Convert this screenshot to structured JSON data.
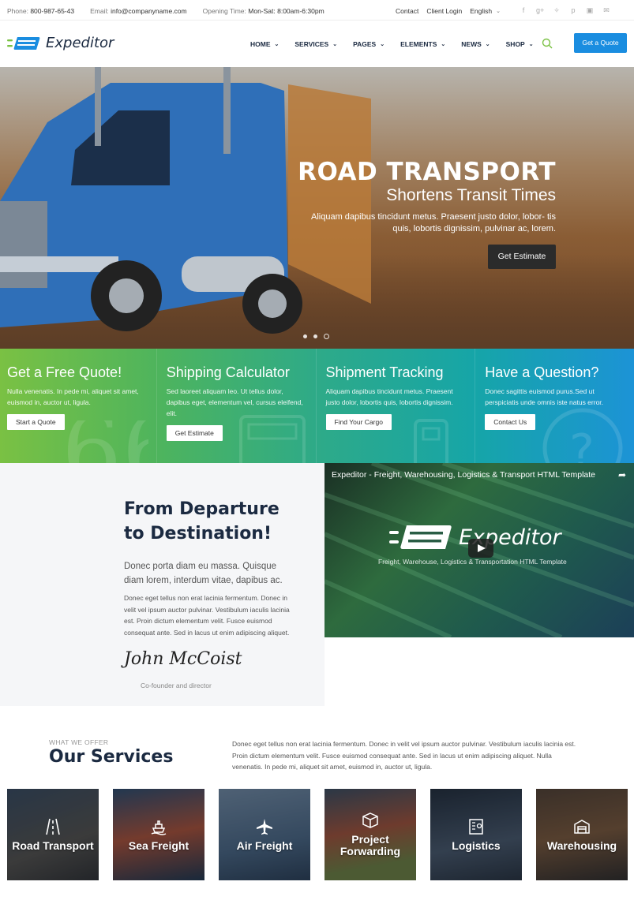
{
  "topbar": {
    "phone_label": "Phone:",
    "phone": "800-987-65-43",
    "email_label": "Email:",
    "email": "info@companyname.com",
    "hours_label": "Opening Time:",
    "hours": "Mon-Sat: 8:00am-6:30pm",
    "contact": "Contact",
    "client_login": "Client Login",
    "language": "English",
    "socials": [
      "facebook-icon",
      "google-plus-icon",
      "twitter-icon",
      "pinterest-icon",
      "instagram-icon",
      "mail-icon"
    ]
  },
  "header": {
    "logo_text": "Expeditor",
    "nav": [
      "HOME",
      "SERVICES",
      "PAGES",
      "ELEMENTS",
      "NEWS",
      "SHOP"
    ],
    "quote_button": "Get a Quote",
    "accent_color": "#1a8de0"
  },
  "hero": {
    "title": "ROAD TRANSPORT",
    "subtitle": "Shortens Transit Times",
    "description": "Aliquam dapibus tincidunt metus. Praesent justo dolor, lobor- tis quis, lobortis dignissim, pulvinar ac, lorem.",
    "button": "Get Estimate"
  },
  "features": [
    {
      "title": "Get a Free Quote!",
      "text": "Nulla venenatis. In pede mi, aliquet sit amet, euismod in, auctor ut, ligula.",
      "button": "Start a Quote"
    },
    {
      "title": "Shipping Calculator",
      "text": "Sed laoreet aliquam leo. Ut tellus dolor, dapibus eget, elementum vel, cursus eleifend, elit.",
      "button": "Get Estimate"
    },
    {
      "title": "Shipment Tracking",
      "text": "Aliquam dapibus tincidunt metus. Praesent justo dolor, lobortis quis, lobortis dignissim.",
      "button": "Find Your Cargo"
    },
    {
      "title": "Have a Question?",
      "text": "Donec sagittis euismod purus.Sed ut perspiciatis unde omnis iste natus error.",
      "button": "Contact Us"
    }
  ],
  "about": {
    "title": "From Departure to Destination!",
    "lead": "Donec porta diam eu massa. Quisque diam lorem, interdum vitae, dapibus ac.",
    "body": "Donec eget tellus non erat lacinia fermentum. Donec in velit vel ipsum auctor pulvinar. Vestibulum iaculis lacinia est. Proin dictum elementum velit. Fusce euismod consequat ante. Sed in lacus ut enim adipiscing aliquet.",
    "signature": "John McCoist",
    "role": "Co-founder and director"
  },
  "video": {
    "title": "Expeditor - Freight, Warehousing, Logistics & Transport HTML Template",
    "logo_text": "Expeditor",
    "subtitle": "Freight, Warehouse, Logistics & Transportation HTML Template"
  },
  "services": {
    "eyebrow": "WHAT WE OFFER",
    "title": "Our Services",
    "description": "Donec eget tellus non erat lacinia fermentum. Donec in velit vel ipsum auctor pulvinar. Vestibulum iaculis lacinia est. Proin dictum elementum velit. Fusce euismod consequat ante. Sed in lacus ut enim adipiscing aliquet. Nulla venenatis. In pede mi, aliquet sit amet, euismod in, auctor ut, ligula.",
    "items": [
      {
        "label": "Road Transport",
        "icon": "road-icon"
      },
      {
        "label": "Sea Freight",
        "icon": "ship-icon"
      },
      {
        "label": "Air Freight",
        "icon": "plane-icon"
      },
      {
        "label": "Project Forwarding",
        "icon": "box-icon"
      },
      {
        "label": "Logistics",
        "icon": "map-icon"
      },
      {
        "label": "Warehousing",
        "icon": "warehouse-icon"
      }
    ]
  }
}
